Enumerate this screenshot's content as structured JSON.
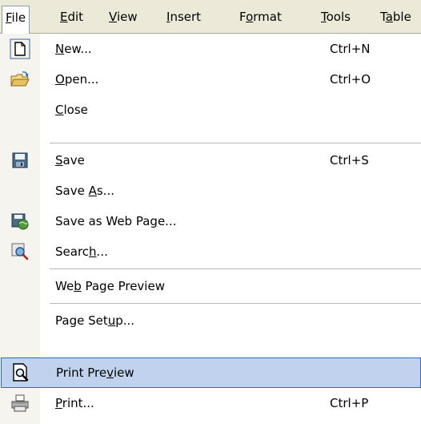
{
  "menubar": {
    "items": [
      {
        "pre": "",
        "mn": "F",
        "post": "ile"
      },
      {
        "pre": "",
        "mn": "E",
        "post": "dit"
      },
      {
        "pre": "",
        "mn": "V",
        "post": "iew"
      },
      {
        "pre": "",
        "mn": "I",
        "post": "nsert"
      },
      {
        "pre": "F",
        "mn": "o",
        "post": "rmat"
      },
      {
        "pre": "",
        "mn": "T",
        "post": "ools"
      },
      {
        "pre": "T",
        "mn": "a",
        "post": "ble"
      }
    ]
  },
  "file_menu": {
    "items": [
      {
        "pre": "",
        "mn": "N",
        "post": "ew...",
        "shortcut": "Ctrl+N",
        "icon": "new-document-icon"
      },
      {
        "pre": "",
        "mn": "O",
        "post": "pen...",
        "shortcut": "Ctrl+O",
        "icon": "open-folder-icon"
      },
      {
        "pre": "",
        "mn": "C",
        "post": "lose",
        "shortcut": "",
        "icon": ""
      },
      {
        "pre": "",
        "mn": "S",
        "post": "ave",
        "shortcut": "Ctrl+S",
        "icon": "save-floppy-icon"
      },
      {
        "pre": "Save ",
        "mn": "A",
        "post": "s...",
        "shortcut": "",
        "icon": ""
      },
      {
        "pre": "Save as Web Pa",
        "mn": "g",
        "post": "e...",
        "shortcut": "",
        "icon": "save-web-page-icon"
      },
      {
        "pre": "Searc",
        "mn": "h",
        "post": "...",
        "shortcut": "",
        "icon": "search-icon"
      },
      {
        "pre": "We",
        "mn": "b",
        "post": " Page Preview",
        "shortcut": "",
        "icon": ""
      },
      {
        "pre": "Page Set",
        "mn": "u",
        "post": "p...",
        "shortcut": "",
        "icon": ""
      },
      {
        "pre": "Print Pre",
        "mn": "v",
        "post": "iew",
        "shortcut": "",
        "icon": "print-preview-icon"
      },
      {
        "pre": "",
        "mn": "P",
        "post": "rint...",
        "shortcut": "Ctrl+P",
        "icon": "printer-icon"
      }
    ],
    "highlighted_index": 9
  },
  "colors": {
    "menubar_bg": "#ece9d8",
    "highlight_bg": "#c1d2ee",
    "highlight_border": "#316ac5",
    "gutter_bg": "#f5f4ee"
  }
}
